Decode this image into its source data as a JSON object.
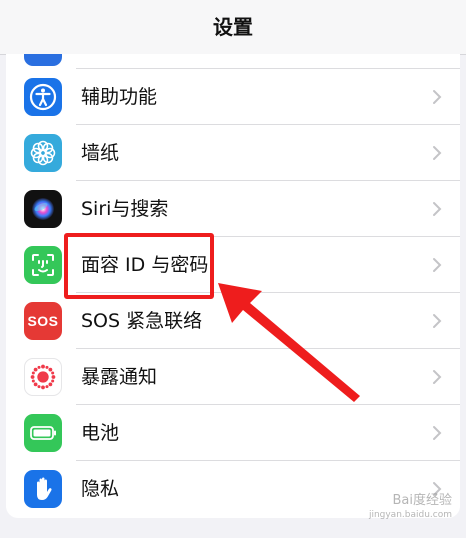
{
  "nav": {
    "title": "设置"
  },
  "rows": [
    {
      "label": "辅助功能",
      "icon": "accessibility-icon",
      "color": "#1a73e8"
    },
    {
      "label": "墙纸",
      "icon": "wallpaper-flower-icon",
      "color": "#35aadc"
    },
    {
      "label": "Siri与搜索",
      "icon": "siri-icon",
      "color": "#222222"
    },
    {
      "label": "面容 ID 与密码",
      "icon": "face-id-icon",
      "color": "#34c759"
    },
    {
      "label": "SOS 紧急联络",
      "icon": "sos-icon",
      "color": "#e53935",
      "icon_text": "SOS"
    },
    {
      "label": "暴露通知",
      "icon": "exposure-notification-icon",
      "color": "#ffffff"
    },
    {
      "label": "电池",
      "icon": "battery-icon",
      "color": "#34c759"
    },
    {
      "label": "隐私",
      "icon": "privacy-hand-icon",
      "color": "#1a73e8"
    }
  ],
  "annotation": {
    "highlight_color": "#ee1d1d"
  },
  "watermark": {
    "text": "Bai度经验",
    "sub": "jingyan.baidu.com"
  }
}
